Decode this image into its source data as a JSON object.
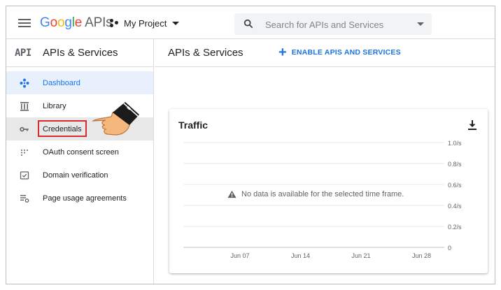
{
  "app": {
    "logo_letters": [
      "G",
      "o",
      "o",
      "g",
      "l",
      "e"
    ],
    "logo_suffix": "APIs",
    "project_name": "My Project"
  },
  "search": {
    "placeholder": "Search for APIs and Services"
  },
  "sidebar": {
    "badge": "API",
    "title": "APIs & Services",
    "items": [
      {
        "label": "Dashboard",
        "icon": "dashboard-icon",
        "state": "active"
      },
      {
        "label": "Library",
        "icon": "library-icon",
        "state": ""
      },
      {
        "label": "Credentials",
        "icon": "key-icon",
        "state": "hover-highlighted"
      },
      {
        "label": "OAuth consent screen",
        "icon": "oauth-icon",
        "state": ""
      },
      {
        "label": "Domain verification",
        "icon": "domain-check-icon",
        "state": ""
      },
      {
        "label": "Page usage agreements",
        "icon": "settings-list-icon",
        "state": ""
      }
    ]
  },
  "main": {
    "title": "APIs & Services",
    "enable_button": "ENABLE APIS AND SERVICES"
  },
  "traffic": {
    "title": "Traffic",
    "empty_message": "No data is available for the selected time frame."
  },
  "colors": {
    "accent": "#1a73e8",
    "highlight_box": "#d32f2f",
    "active_nav_bg": "#e8f0fe"
  },
  "chart_data": {
    "type": "line",
    "title": "Traffic",
    "x_tick_labels": [
      "Jun 07",
      "Jun 14",
      "Jun 21",
      "Jun 28"
    ],
    "y_tick_labels": [
      "1.0/s",
      "0.8/s",
      "0.6/s",
      "0.4/s",
      "0.2/s",
      "0"
    ],
    "ylim": [
      0,
      1.0
    ],
    "series": [],
    "grid": true
  }
}
